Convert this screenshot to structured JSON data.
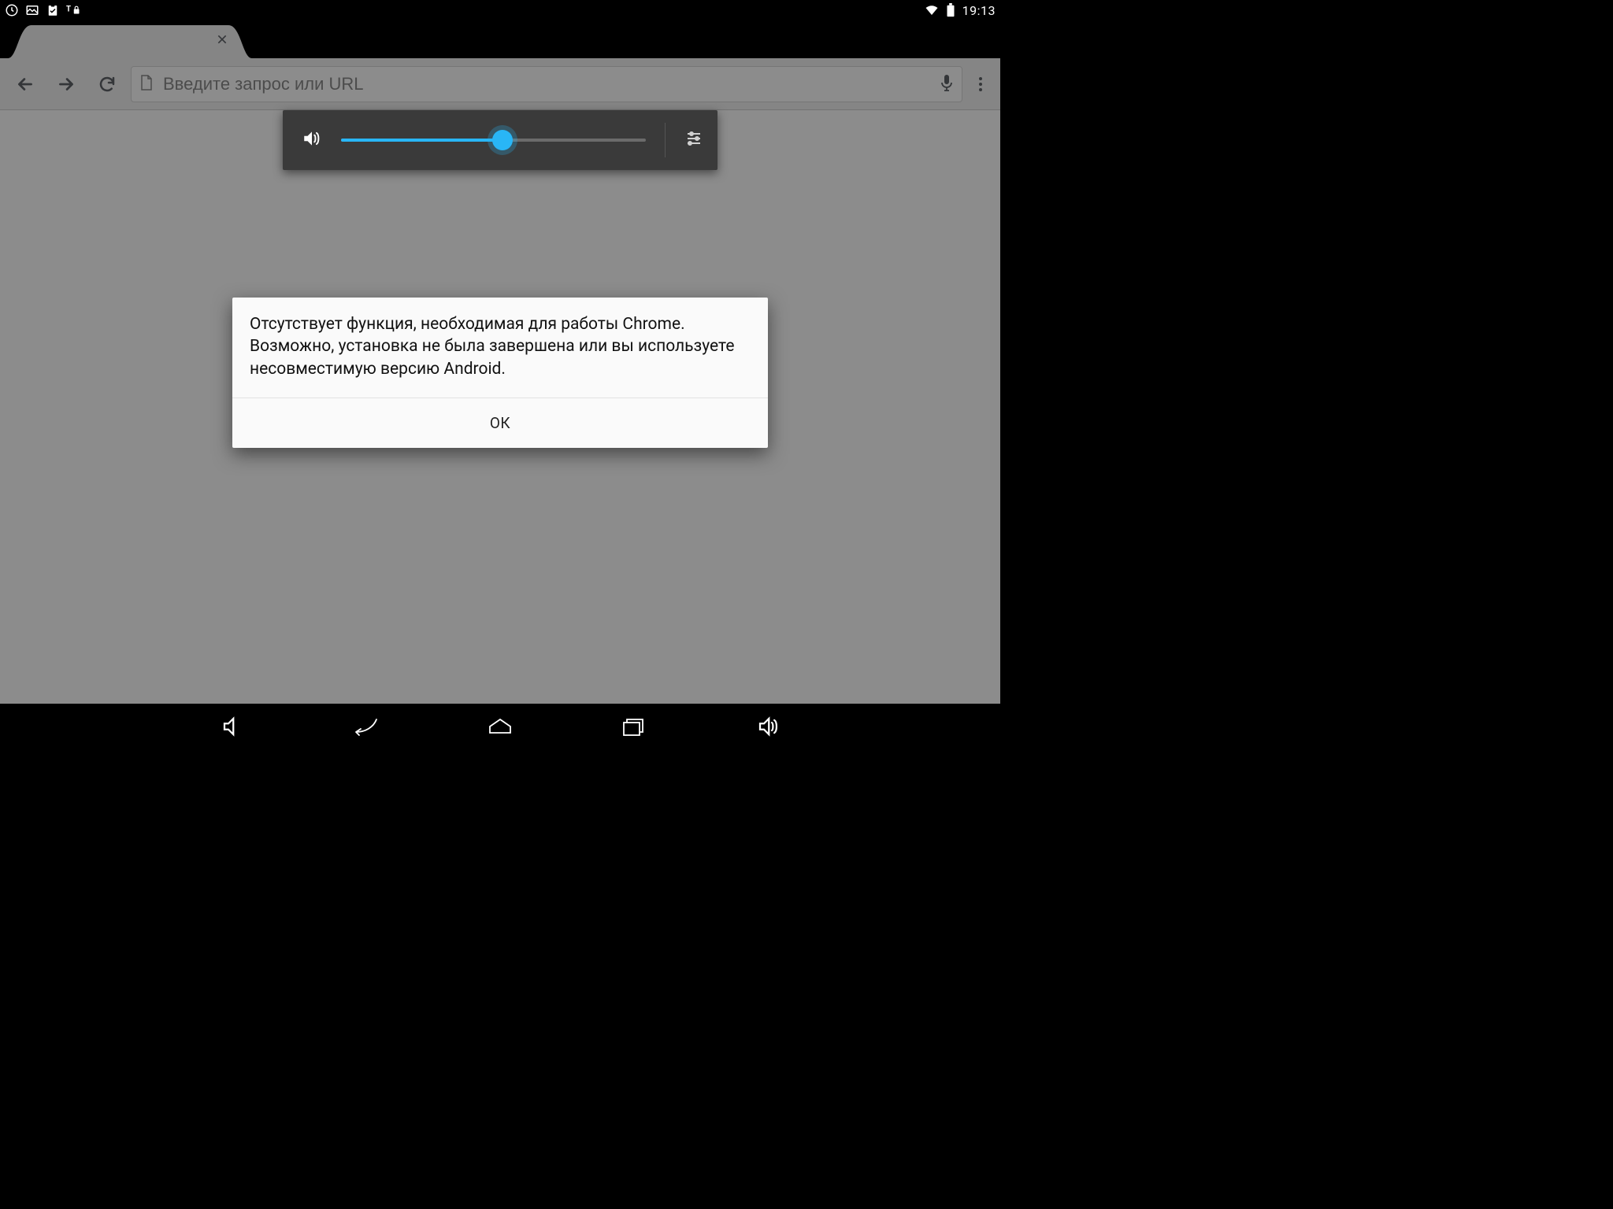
{
  "status": {
    "time": "19:13",
    "icons_left": [
      "update-icon",
      "image-icon",
      "clipboard-check-icon",
      "text-lock-icon"
    ],
    "icons_right": [
      "wifi-icon",
      "battery-full-icon"
    ]
  },
  "tab": {
    "close_label": "×"
  },
  "toolbar": {
    "omnibox_placeholder": "Введите запрос или URL"
  },
  "volume": {
    "percent": 53
  },
  "dialog": {
    "message": "Отсутствует функция, необходимая для работы Chrome. Возможно, установка не была завершена или вы используете несовместимую версию Android.",
    "ok_label": "ОК"
  }
}
